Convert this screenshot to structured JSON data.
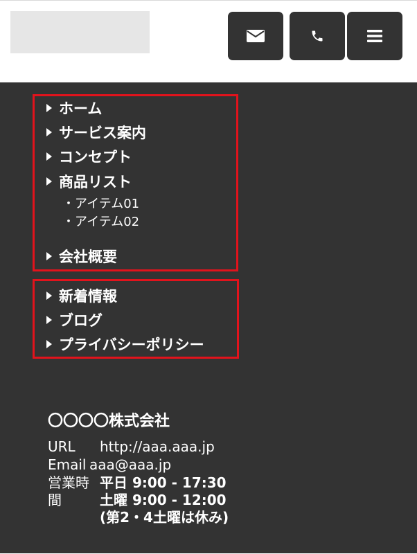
{
  "header": {
    "buttons": [
      {
        "name": "mail",
        "icon": "envelope-icon"
      },
      {
        "name": "phone",
        "icon": "phone-icon"
      },
      {
        "name": "menu",
        "icon": "hamburger-menu-icon"
      }
    ]
  },
  "nav": {
    "group1": [
      {
        "label": "ホーム"
      },
      {
        "label": "サービス案内"
      },
      {
        "label": "コンセプト"
      },
      {
        "label": "商品リスト"
      }
    ],
    "sub_items": [
      {
        "label": "・アイテム01"
      },
      {
        "label": "・アイテム02"
      }
    ],
    "group1_last": {
      "label": "会社概要"
    },
    "group2": [
      {
        "label": "新着情報"
      },
      {
        "label": "ブログ"
      },
      {
        "label": "プライバシーポリシー"
      }
    ]
  },
  "company": {
    "name": "〇〇〇〇株式会社",
    "url_label": "URL",
    "url": "http://aaa.aaa.jp",
    "email_label": "Email",
    "email": "aaa@aaa.jp",
    "hours_label_1": "営業時",
    "hours_label_2": "間",
    "weekday": "平日 9:00 - 17:30",
    "saturday": "土曜 9:00 - 12:00",
    "note": "(第2・4土曜は休み)"
  },
  "colors": {
    "panel": "#333333",
    "button": "#333333",
    "highlight_border": "#e2131c",
    "logo_placeholder": "#e6e6e6"
  }
}
